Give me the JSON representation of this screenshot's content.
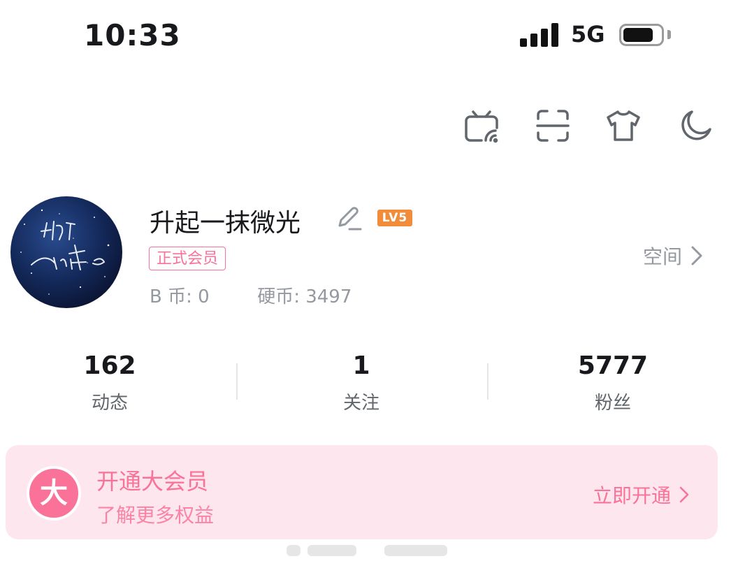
{
  "status_bar": {
    "time": "10:33",
    "network": "5G",
    "battery_level": 0.8,
    "signal_bars": 4
  },
  "toolbar": {
    "icons": [
      "tv-icon",
      "scan-icon",
      "theme-shirt-icon",
      "night-mode-icon"
    ]
  },
  "profile": {
    "username": "升起一抹微光",
    "level": "LV5",
    "vip_tag": "正式会员",
    "b_coin": "B 币: 0",
    "hard_coin": "硬币: 3497",
    "space_link": "空间"
  },
  "stats": [
    {
      "value": "162",
      "label": "动态"
    },
    {
      "value": "1",
      "label": "关注"
    },
    {
      "value": "5777",
      "label": "粉丝"
    }
  ],
  "vip_banner": {
    "badge": "大",
    "title": "开通大会员",
    "subtitle": "了解更多权益",
    "action": "立即开通"
  },
  "colors": {
    "accent": "#fb7299",
    "banner_bg": "#fde6ee",
    "level": "#f08c3a",
    "muted": "#9499a0"
  }
}
